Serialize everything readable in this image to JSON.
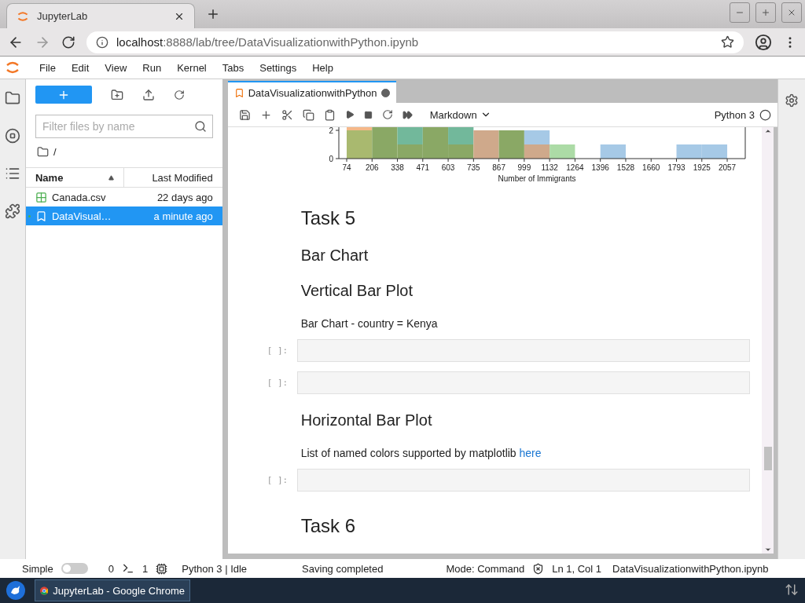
{
  "browser": {
    "tab_title": "JupyterLab",
    "url_host": "localhost",
    "url_path": ":8888/lab/tree/DataVisualizationwithPython.ipynb"
  },
  "menu": [
    "File",
    "Edit",
    "View",
    "Run",
    "Kernel",
    "Tabs",
    "Settings",
    "Help"
  ],
  "file_browser": {
    "filter_placeholder": "Filter files by name",
    "path": "/",
    "columns": [
      "Name",
      "Last Modified"
    ],
    "files": [
      {
        "kind": "csv",
        "name": "Canada.csv",
        "modified": "22 days ago",
        "selected": false,
        "running": false
      },
      {
        "kind": "notebook",
        "name": "DataVisual…",
        "modified": "a minute ago",
        "selected": true,
        "running": true
      }
    ]
  },
  "notebook": {
    "tab_title": "DataVisualizationwithPython",
    "dirty": true,
    "cell_type": "Markdown",
    "kernel": "Python 3",
    "kernel_busy": false,
    "histogram": {
      "yticks": [
        "2",
        "0"
      ],
      "xticks": [
        "74",
        "206",
        "338",
        "471",
        "603",
        "735",
        "867",
        "999",
        "1132",
        "1264",
        "1396",
        "1528",
        "1660",
        "1793",
        "1925",
        "2057"
      ],
      "xlabel": "Number of Immigrants"
    },
    "cells": [
      {
        "kind": "h1",
        "text": "Task 5"
      },
      {
        "kind": "h2",
        "text": "Bar Chart"
      },
      {
        "kind": "h2",
        "text": "Vertical Bar Plot"
      },
      {
        "kind": "p",
        "text": "Bar Chart - country = Kenya"
      },
      {
        "kind": "code",
        "prompt": "[ ]:"
      },
      {
        "kind": "code",
        "prompt": "[ ]:"
      },
      {
        "kind": "h2",
        "text": "Horizontal Bar Plot"
      },
      {
        "kind": "p",
        "text": "List of named colors supported by matplotlib",
        "link": "here"
      },
      {
        "kind": "code",
        "prompt": "[ ]:"
      },
      {
        "kind": "h1",
        "text": "Task 6"
      }
    ]
  },
  "status_bar": {
    "mode_label": "Simple",
    "simple_on": false,
    "terminals": "0",
    "kernels": "1",
    "kernel_status": "Python 3 | Idle",
    "message": "Saving completed",
    "mode": "Mode: Command",
    "position": "Ln 1, Col 1",
    "file": "DataVisualizationwithPython.ipynb"
  },
  "taskbar": {
    "window_title": "JupyterLab - Google Chrome"
  }
}
